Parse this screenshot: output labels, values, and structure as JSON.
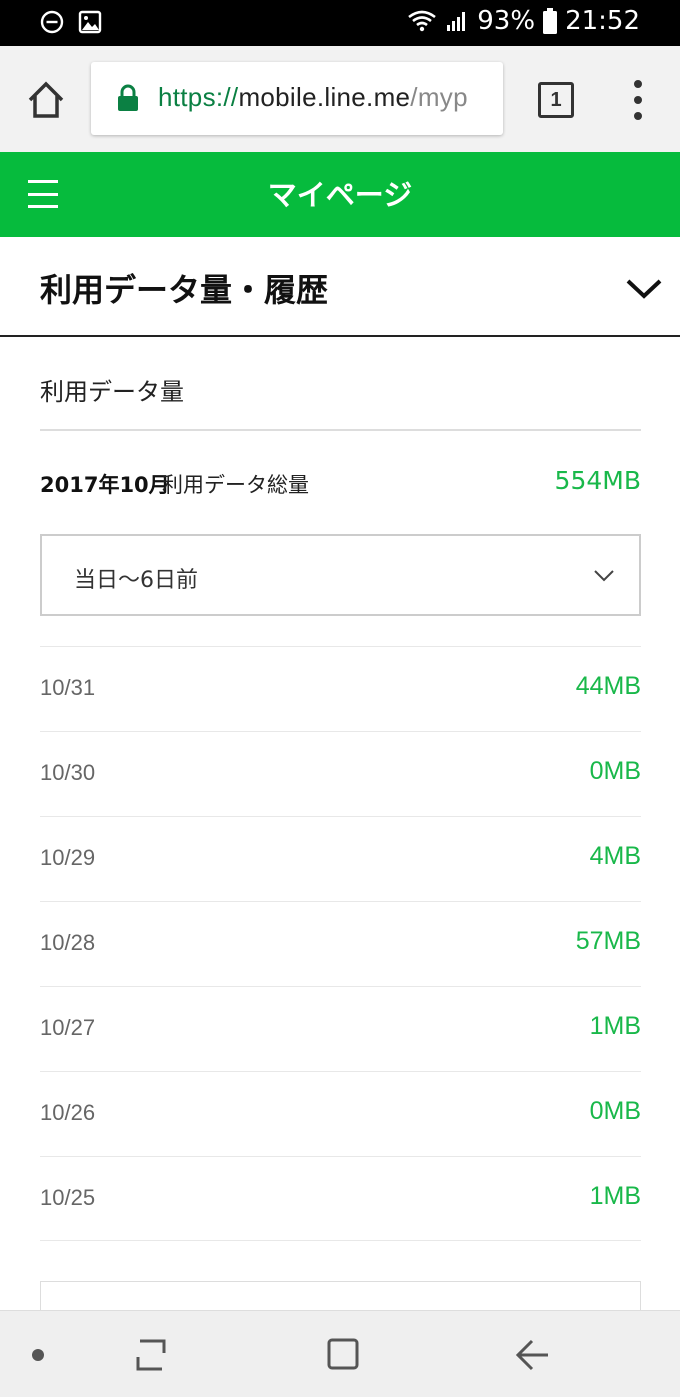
{
  "status_bar": {
    "battery_percent": "93%",
    "time": "21:52"
  },
  "browser": {
    "url_scheme": "https://",
    "url_host": "mobile.line.me",
    "url_path": "/myp",
    "tab_count": "1"
  },
  "header": {
    "title": "マイページ"
  },
  "section": {
    "title": "利用データ量・履歴",
    "usage_label": "利用データ量"
  },
  "total": {
    "month": "2017年10月",
    "caption": "利用データ総量",
    "value": "554MB"
  },
  "range_select": {
    "selected": "当日〜6日前"
  },
  "days": [
    {
      "date": "10/31",
      "value": "44MB"
    },
    {
      "date": "10/30",
      "value": "0MB"
    },
    {
      "date": "10/29",
      "value": "4MB"
    },
    {
      "date": "10/28",
      "value": "57MB"
    },
    {
      "date": "10/27",
      "value": "1MB"
    },
    {
      "date": "10/26",
      "value": "0MB"
    },
    {
      "date": "10/25",
      "value": "1MB"
    }
  ],
  "colors": {
    "brand_green": "#06bb3d",
    "value_green": "#19b84a",
    "url_green": "#0b8043"
  },
  "icons": {
    "status_left": [
      "minus-circle-icon",
      "image-icon"
    ],
    "status_right": [
      "wifi-icon",
      "signal-icon",
      "battery-icon"
    ],
    "browser": [
      "home-icon",
      "lock-icon",
      "tab-switcher-icon",
      "more-vert-icon"
    ],
    "header": [
      "hamburger-menu-icon"
    ],
    "section": [
      "chevron-down-icon"
    ],
    "nav": [
      "nav-dot-icon",
      "recent-apps-icon",
      "home-square-icon",
      "back-arrow-icon"
    ]
  }
}
